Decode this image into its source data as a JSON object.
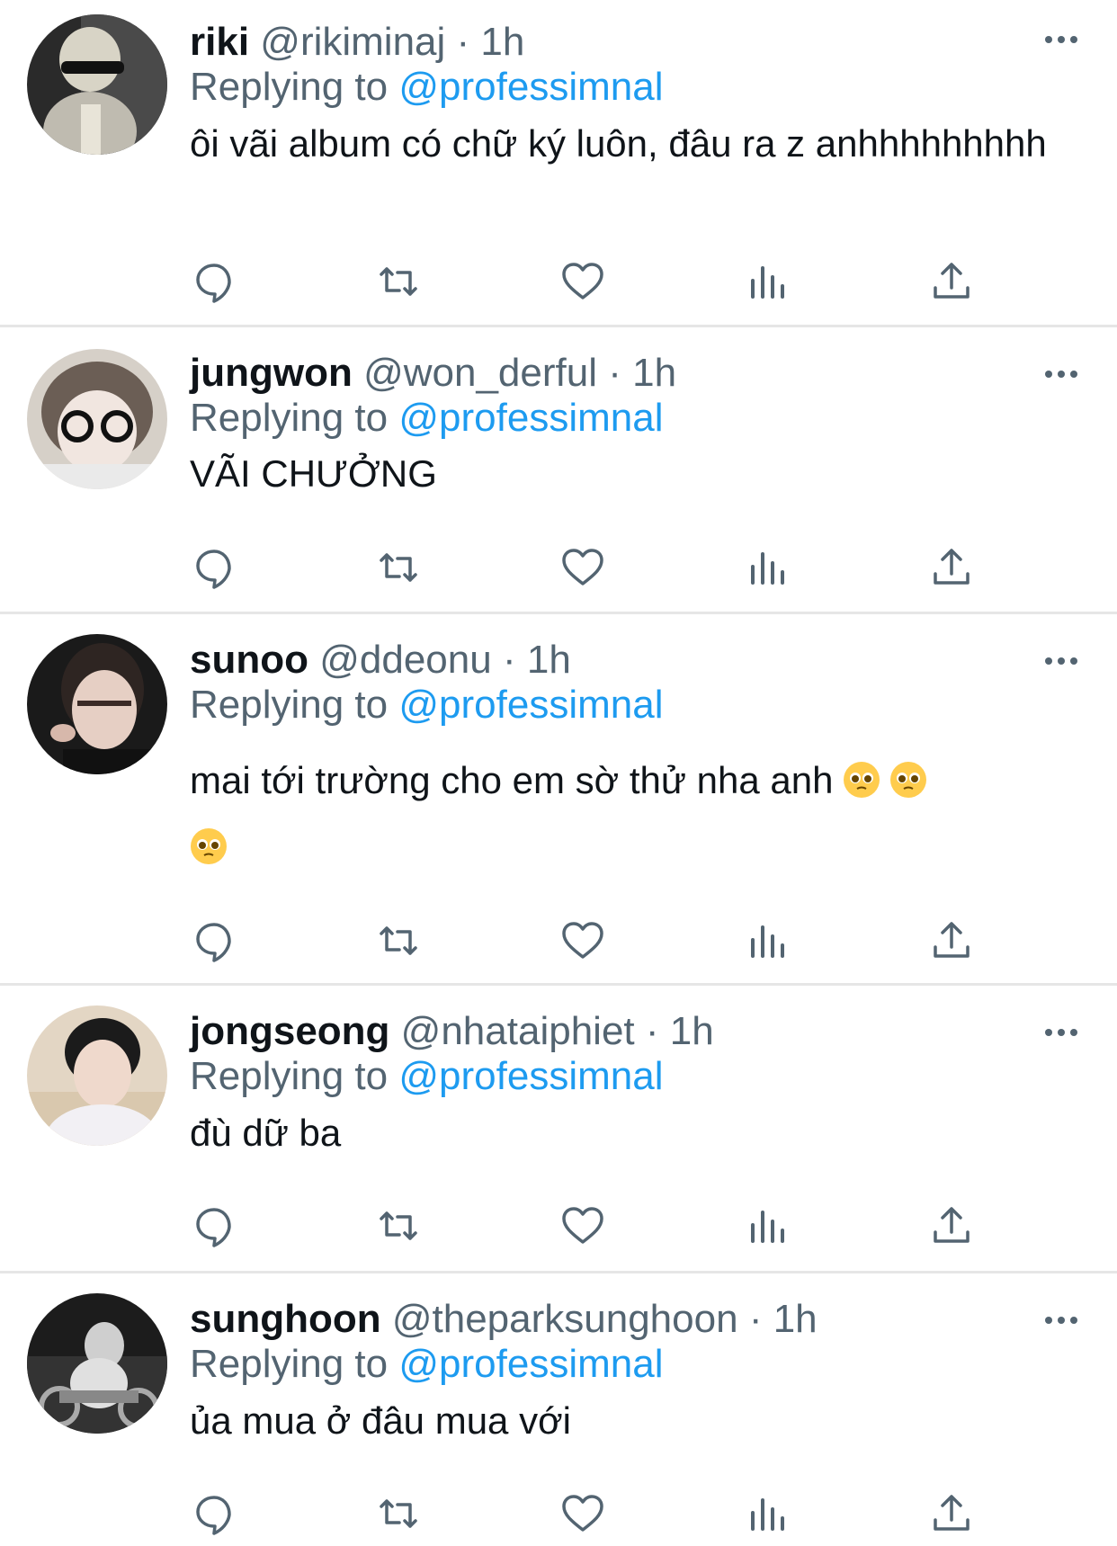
{
  "colors": {
    "name": "#0f1419",
    "secondary": "#536471",
    "mention": "#1d9bf0",
    "divider": "#e6e6e6"
  },
  "replies": [
    {
      "name": "riki",
      "handle": "@rikiminaj",
      "sep": "·",
      "time": "1h",
      "replying_prefix": "Replying to",
      "mention": "@professimnal",
      "text": "ôi vãi album có chữ ký luôn, đâu ra z anhhhhhhhhh",
      "emojis": []
    },
    {
      "name": "jungwon",
      "handle": "@won_derful",
      "sep": "·",
      "time": "1h",
      "replying_prefix": "Replying to",
      "mention": "@professimnal",
      "text": "VÃI CHƯỞNG",
      "emojis": []
    },
    {
      "name": "sunoo",
      "handle": "@ddeonu",
      "sep": "·",
      "time": "1h",
      "replying_prefix": "Replying to",
      "mention": "@professimnal",
      "text": "mai tới trường cho em sờ thử nha anh",
      "emojis": [
        "pleading-face-emoji",
        "pleading-face-emoji",
        "pleading-face-emoji"
      ]
    },
    {
      "name": "jongseong",
      "handle": "@nhataiphiet",
      "sep": "·",
      "time": "1h",
      "replying_prefix": "Replying to",
      "mention": "@professimnal",
      "text": "đù dữ ba",
      "emojis": []
    },
    {
      "name": "sunghoon",
      "handle": "@theparksunghoon",
      "sep": "·",
      "time": "1h",
      "replying_prefix": "Replying to",
      "mention": "@professimnal",
      "text": "ủa mua ở đâu mua với",
      "emojis": []
    }
  ],
  "action_icons": [
    "reply-icon",
    "retweet-icon",
    "like-icon",
    "analytics-icon",
    "share-icon"
  ],
  "more_icon": "more-options-icon"
}
